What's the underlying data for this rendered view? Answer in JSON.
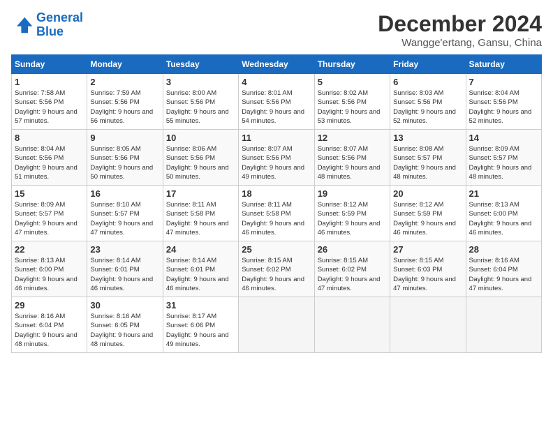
{
  "header": {
    "logo_line1": "General",
    "logo_line2": "Blue",
    "month": "December 2024",
    "location": "Wangge'ertang, Gansu, China"
  },
  "weekdays": [
    "Sunday",
    "Monday",
    "Tuesday",
    "Wednesday",
    "Thursday",
    "Friday",
    "Saturday"
  ],
  "weeks": [
    [
      {
        "day": "1",
        "rise": "7:58 AM",
        "set": "5:56 PM",
        "daylight": "9 hours and 57 minutes."
      },
      {
        "day": "2",
        "rise": "7:59 AM",
        "set": "5:56 PM",
        "daylight": "9 hours and 56 minutes."
      },
      {
        "day": "3",
        "rise": "8:00 AM",
        "set": "5:56 PM",
        "daylight": "9 hours and 55 minutes."
      },
      {
        "day": "4",
        "rise": "8:01 AM",
        "set": "5:56 PM",
        "daylight": "9 hours and 54 minutes."
      },
      {
        "day": "5",
        "rise": "8:02 AM",
        "set": "5:56 PM",
        "daylight": "9 hours and 53 minutes."
      },
      {
        "day": "6",
        "rise": "8:03 AM",
        "set": "5:56 PM",
        "daylight": "9 hours and 52 minutes."
      },
      {
        "day": "7",
        "rise": "8:04 AM",
        "set": "5:56 PM",
        "daylight": "9 hours and 52 minutes."
      }
    ],
    [
      {
        "day": "8",
        "rise": "8:04 AM",
        "set": "5:56 PM",
        "daylight": "9 hours and 51 minutes."
      },
      {
        "day": "9",
        "rise": "8:05 AM",
        "set": "5:56 PM",
        "daylight": "9 hours and 50 minutes."
      },
      {
        "day": "10",
        "rise": "8:06 AM",
        "set": "5:56 PM",
        "daylight": "9 hours and 50 minutes."
      },
      {
        "day": "11",
        "rise": "8:07 AM",
        "set": "5:56 PM",
        "daylight": "9 hours and 49 minutes."
      },
      {
        "day": "12",
        "rise": "8:07 AM",
        "set": "5:56 PM",
        "daylight": "9 hours and 48 minutes."
      },
      {
        "day": "13",
        "rise": "8:08 AM",
        "set": "5:57 PM",
        "daylight": "9 hours and 48 minutes."
      },
      {
        "day": "14",
        "rise": "8:09 AM",
        "set": "5:57 PM",
        "daylight": "9 hours and 48 minutes."
      }
    ],
    [
      {
        "day": "15",
        "rise": "8:09 AM",
        "set": "5:57 PM",
        "daylight": "9 hours and 47 minutes."
      },
      {
        "day": "16",
        "rise": "8:10 AM",
        "set": "5:57 PM",
        "daylight": "9 hours and 47 minutes."
      },
      {
        "day": "17",
        "rise": "8:11 AM",
        "set": "5:58 PM",
        "daylight": "9 hours and 47 minutes."
      },
      {
        "day": "18",
        "rise": "8:11 AM",
        "set": "5:58 PM",
        "daylight": "9 hours and 46 minutes."
      },
      {
        "day": "19",
        "rise": "8:12 AM",
        "set": "5:59 PM",
        "daylight": "9 hours and 46 minutes."
      },
      {
        "day": "20",
        "rise": "8:12 AM",
        "set": "5:59 PM",
        "daylight": "9 hours and 46 minutes."
      },
      {
        "day": "21",
        "rise": "8:13 AM",
        "set": "6:00 PM",
        "daylight": "9 hours and 46 minutes."
      }
    ],
    [
      {
        "day": "22",
        "rise": "8:13 AM",
        "set": "6:00 PM",
        "daylight": "9 hours and 46 minutes."
      },
      {
        "day": "23",
        "rise": "8:14 AM",
        "set": "6:01 PM",
        "daylight": "9 hours and 46 minutes."
      },
      {
        "day": "24",
        "rise": "8:14 AM",
        "set": "6:01 PM",
        "daylight": "9 hours and 46 minutes."
      },
      {
        "day": "25",
        "rise": "8:15 AM",
        "set": "6:02 PM",
        "daylight": "9 hours and 46 minutes."
      },
      {
        "day": "26",
        "rise": "8:15 AM",
        "set": "6:02 PM",
        "daylight": "9 hours and 47 minutes."
      },
      {
        "day": "27",
        "rise": "8:15 AM",
        "set": "6:03 PM",
        "daylight": "9 hours and 47 minutes."
      },
      {
        "day": "28",
        "rise": "8:16 AM",
        "set": "6:04 PM",
        "daylight": "9 hours and 47 minutes."
      }
    ],
    [
      {
        "day": "29",
        "rise": "8:16 AM",
        "set": "6:04 PM",
        "daylight": "9 hours and 48 minutes."
      },
      {
        "day": "30",
        "rise": "8:16 AM",
        "set": "6:05 PM",
        "daylight": "9 hours and 48 minutes."
      },
      {
        "day": "31",
        "rise": "8:17 AM",
        "set": "6:06 PM",
        "daylight": "9 hours and 49 minutes."
      },
      null,
      null,
      null,
      null
    ]
  ]
}
